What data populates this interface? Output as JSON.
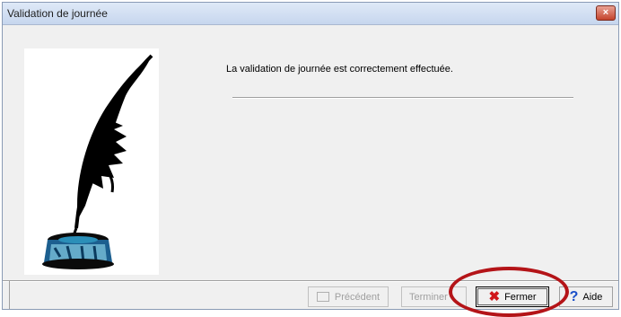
{
  "window": {
    "title": "Validation de journée",
    "close_glyph": "×"
  },
  "illustration": {
    "icon": "quill-inkwell-icon"
  },
  "message": "La validation de journée est correctement effectuée.",
  "buttons": {
    "previous": {
      "label": "Précédent",
      "enabled": false,
      "icon": "back-icon"
    },
    "finish": {
      "label": "Terminer",
      "enabled": false
    },
    "close": {
      "label": "Fermer",
      "enabled": true,
      "icon": "red-x-icon",
      "icon_glyph": "✖"
    },
    "help": {
      "label": "Aide",
      "enabled": true,
      "icon": "question-mark-icon",
      "icon_glyph": "?"
    }
  },
  "colors": {
    "highlight": "#b41418",
    "close_x": "#d0161a",
    "help_q": "#1a4fc9"
  }
}
